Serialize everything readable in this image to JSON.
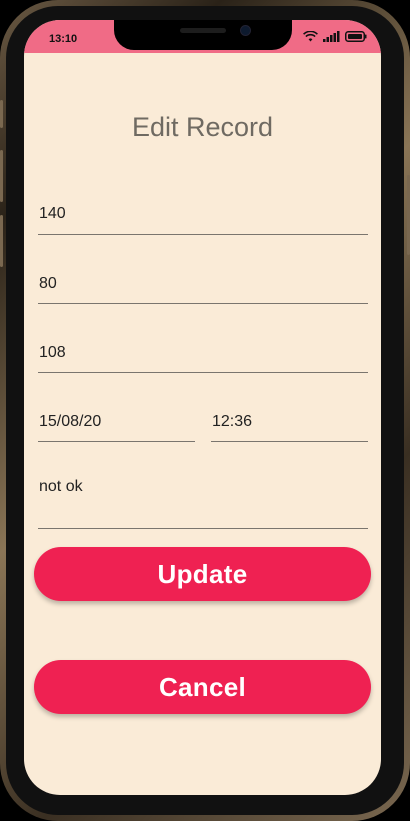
{
  "status_bar": {
    "time": "13:10",
    "color": "#f06b86",
    "icons": [
      "wifi-icon",
      "signal-icon",
      "battery-icon"
    ]
  },
  "page": {
    "title": "Edit Record",
    "background": "#faebd7"
  },
  "form": {
    "systolic_value": "140",
    "diastolic_value": "80",
    "pulse_value": "108",
    "date_value": "15/08/20",
    "time_value": "12:36",
    "note_value": "not ok"
  },
  "buttons": {
    "update_label": "Update",
    "cancel_label": "Cancel",
    "color": "#ef2152"
  }
}
